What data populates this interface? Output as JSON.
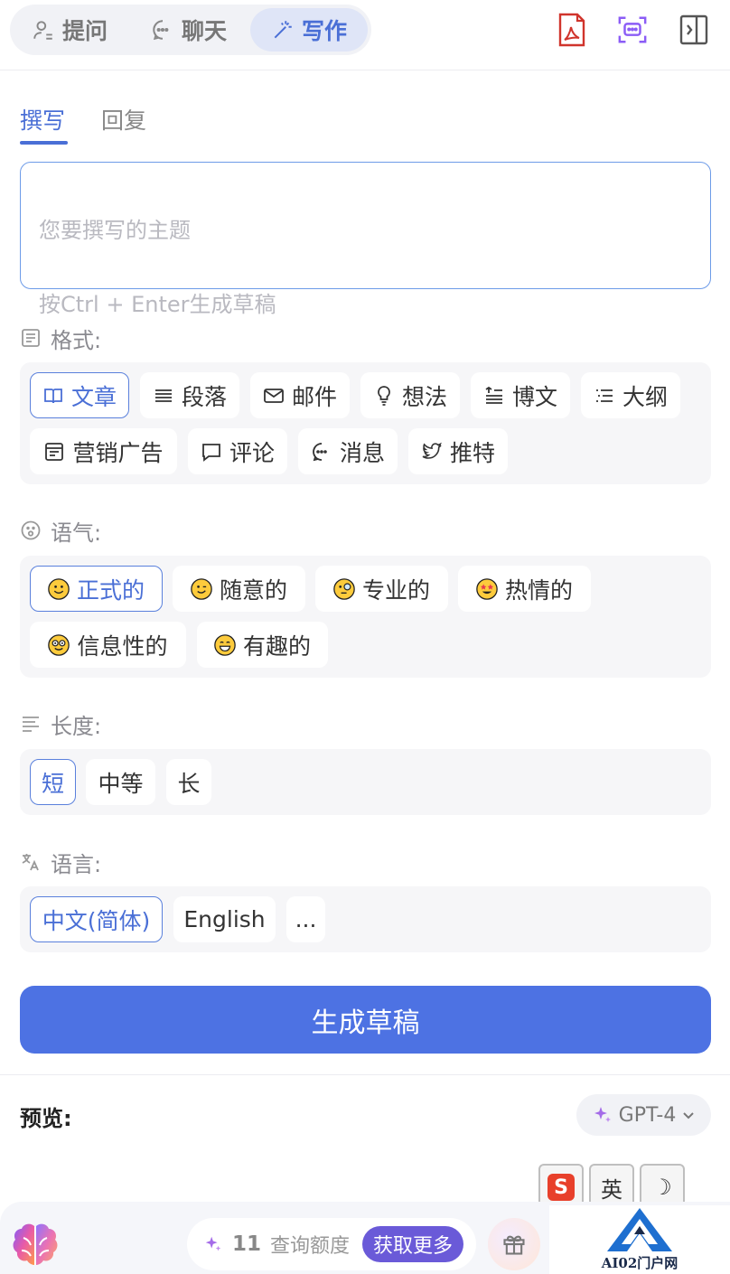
{
  "header": {
    "tabs": [
      {
        "label": "提问",
        "icon": "person-question-icon"
      },
      {
        "label": "聊天",
        "icon": "chat-bubble-icon"
      },
      {
        "label": "写作",
        "icon": "magic-wand-icon",
        "active": true
      }
    ],
    "actions": [
      "pdf-icon",
      "screenshot-chat-icon",
      "sidebar-toggle-icon"
    ]
  },
  "subtabs": [
    {
      "label": "撰写",
      "active": true
    },
    {
      "label": "回复"
    }
  ],
  "topic": {
    "placeholder_line1": "您要撰写的主题",
    "placeholder_line2": "按Ctrl + Enter生成草稿"
  },
  "format": {
    "label": "格式:",
    "options": [
      {
        "label": "文章",
        "icon": "book-icon",
        "active": true
      },
      {
        "label": "段落",
        "icon": "lines-icon"
      },
      {
        "label": "邮件",
        "icon": "mail-icon"
      },
      {
        "label": "想法",
        "icon": "lightbulb-icon"
      },
      {
        "label": "博文",
        "icon": "blog-icon"
      },
      {
        "label": "大纲",
        "icon": "list-icon"
      },
      {
        "label": "营销广告",
        "icon": "ad-icon"
      },
      {
        "label": "评论",
        "icon": "comment-icon"
      },
      {
        "label": "消息",
        "icon": "message-icon"
      },
      {
        "label": "推特",
        "icon": "twitter-bird-icon"
      }
    ]
  },
  "tone": {
    "label": "语气:",
    "options": [
      {
        "label": "正式的",
        "icon": "smile-emoji",
        "active": true
      },
      {
        "label": "随意的",
        "icon": "wink-emoji"
      },
      {
        "label": "专业的",
        "icon": "monocle-emoji"
      },
      {
        "label": "热情的",
        "icon": "star-eyes-emoji"
      },
      {
        "label": "信息性的",
        "icon": "nerd-emoji"
      },
      {
        "label": "有趣的",
        "icon": "grin-emoji"
      }
    ]
  },
  "length": {
    "label": "长度:",
    "options": [
      {
        "label": "短",
        "active": true
      },
      {
        "label": "中等"
      },
      {
        "label": "长"
      }
    ]
  },
  "language": {
    "label": "语言:",
    "options": [
      {
        "label": "中文(简体)",
        "active": true
      },
      {
        "label": "English"
      },
      {
        "label": "..."
      }
    ]
  },
  "generate_label": "生成草稿",
  "preview": {
    "label": "预览:",
    "model": "GPT-4"
  },
  "ime": {
    "keys": [
      "S",
      "英",
      "☽"
    ]
  },
  "footer": {
    "quota_count": "11",
    "quota_label": "查询额度",
    "more_label": "获取更多"
  },
  "watermark": "AI02门户网",
  "colors": {
    "accent": "#4a6fd6",
    "button": "#4d72e3",
    "purple": "#6a5ad8",
    "panel": "#f6f6f8"
  }
}
